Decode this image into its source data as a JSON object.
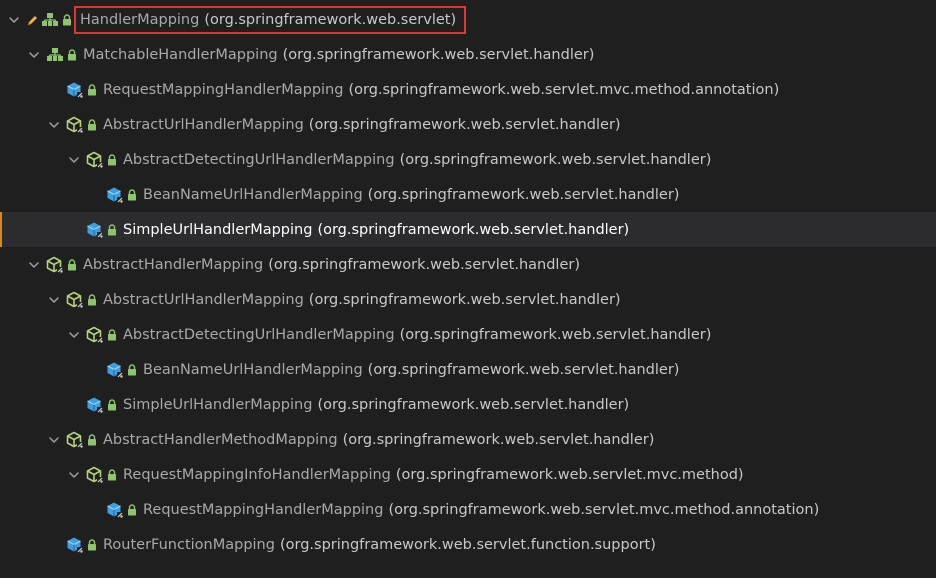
{
  "icon_colors": {
    "interface": "#8ec46d",
    "abstract_class": "#b5d17c",
    "class": "#3d9fe0",
    "lock": "#8ec46d",
    "pencil": "#f0b53a",
    "chevron": "#a0a0a0",
    "highlight_box": "#e03535",
    "selected_marker": "#d6891f"
  },
  "hierarchy": {
    "rows": [
      {
        "level": 0,
        "expand": "expanded",
        "kind": "interface",
        "pencil": true,
        "name": "HandlerMapping",
        "package": "(org.springframework.web.servlet)",
        "highlighted": true
      },
      {
        "level": 1,
        "expand": "expanded",
        "kind": "interface",
        "name": "MatchableHandlerMapping",
        "package": "(org.springframework.web.servlet.handler)"
      },
      {
        "level": 2,
        "expand": "none",
        "kind": "class",
        "name": "RequestMappingHandlerMapping",
        "package": "(org.springframework.web.servlet.mvc.method.annotation)"
      },
      {
        "level": 2,
        "expand": "expanded",
        "kind": "abstract_class",
        "name": "AbstractUrlHandlerMapping",
        "package": "(org.springframework.web.servlet.handler)"
      },
      {
        "level": 3,
        "expand": "expanded",
        "kind": "abstract_class",
        "name": "AbstractDetectingUrlHandlerMapping",
        "package": "(org.springframework.web.servlet.handler)"
      },
      {
        "level": 4,
        "expand": "none",
        "kind": "class",
        "name": "BeanNameUrlHandlerMapping",
        "package": "(org.springframework.web.servlet.handler)"
      },
      {
        "level": 3,
        "expand": "none",
        "kind": "class",
        "name": "SimpleUrlHandlerMapping",
        "package": "(org.springframework.web.servlet.handler)",
        "selected": true
      },
      {
        "level": 1,
        "expand": "expanded",
        "kind": "abstract_class",
        "name": "AbstractHandlerMapping",
        "package": "(org.springframework.web.servlet.handler)"
      },
      {
        "level": 2,
        "expand": "expanded",
        "kind": "abstract_class",
        "name": "AbstractUrlHandlerMapping",
        "package": "(org.springframework.web.servlet.handler)"
      },
      {
        "level": 3,
        "expand": "expanded",
        "kind": "abstract_class",
        "name": "AbstractDetectingUrlHandlerMapping",
        "package": "(org.springframework.web.servlet.handler)"
      },
      {
        "level": 4,
        "expand": "none",
        "kind": "class",
        "name": "BeanNameUrlHandlerMapping",
        "package": "(org.springframework.web.servlet.handler)"
      },
      {
        "level": 3,
        "expand": "none",
        "kind": "class",
        "name": "SimpleUrlHandlerMapping",
        "package": "(org.springframework.web.servlet.handler)"
      },
      {
        "level": 2,
        "expand": "expanded",
        "kind": "abstract_class",
        "name": "AbstractHandlerMethodMapping",
        "package": "(org.springframework.web.servlet.handler)"
      },
      {
        "level": 3,
        "expand": "expanded",
        "kind": "abstract_class",
        "name": "RequestMappingInfoHandlerMapping",
        "package": "(org.springframework.web.servlet.mvc.method)"
      },
      {
        "level": 4,
        "expand": "none",
        "kind": "class",
        "name": "RequestMappingHandlerMapping",
        "package": "(org.springframework.web.servlet.mvc.method.annotation)"
      },
      {
        "level": 2,
        "expand": "none",
        "kind": "class",
        "name": "RouterFunctionMapping",
        "package": "(org.springframework.web.servlet.function.support)"
      }
    ]
  }
}
